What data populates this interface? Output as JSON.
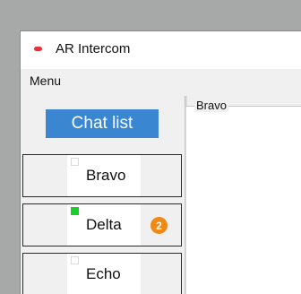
{
  "window": {
    "title": "AR Intercom"
  },
  "menubar": {
    "menu_label": "Menu"
  },
  "chat_list": {
    "header": "Chat list",
    "items": [
      {
        "name": "Bravo",
        "online": false,
        "badge": ""
      },
      {
        "name": "Delta",
        "online": true,
        "badge": "2"
      },
      {
        "name": "Echo",
        "online": false,
        "badge": ""
      }
    ]
  },
  "chat_panel": {
    "group_label": "Bravo"
  },
  "colors": {
    "accent": "#3a86d0",
    "online": "#17d12a",
    "badge": "#ef8a18",
    "app_icon": "#e0343f"
  }
}
